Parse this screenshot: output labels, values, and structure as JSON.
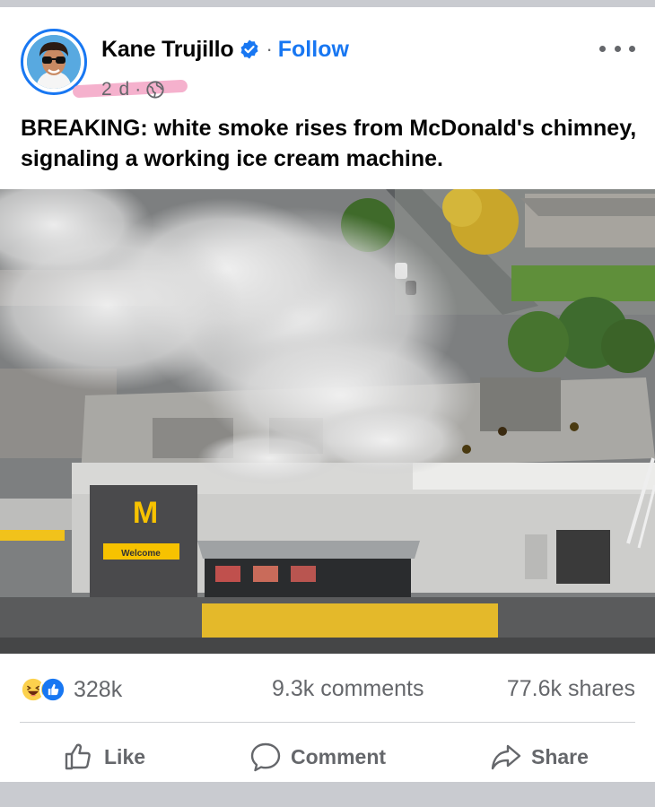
{
  "post": {
    "author": "Kane Trujillo",
    "follow_label": "Follow",
    "separator": "·",
    "time": "2 d",
    "meta_dot": "·",
    "text": "BREAKING: white smoke rises from McDonald's chimney, signaling a working ice cream machine.",
    "photo": {
      "sign_label": "Welcome"
    }
  },
  "stats": {
    "reactions_count": "328k",
    "comments": "9.3k comments",
    "shares": "77.6k shares"
  },
  "actions": {
    "like_label": "Like",
    "comment_label": "Comment",
    "share_label": "Share"
  },
  "icons": {
    "verified": "verified-badge-icon",
    "privacy": "globe-icon",
    "more": "more-options-icon",
    "haha": "haha-reaction-icon",
    "like_reaction": "like-reaction-icon",
    "like": "thumbs-up-icon",
    "comment": "speech-bubble-icon",
    "share": "share-arrow-icon"
  },
  "colors": {
    "brand_blue": "#1877f2",
    "secondary_text": "#65676b",
    "primary_text": "#050505",
    "highlight_pink": "#f4a8c8"
  }
}
